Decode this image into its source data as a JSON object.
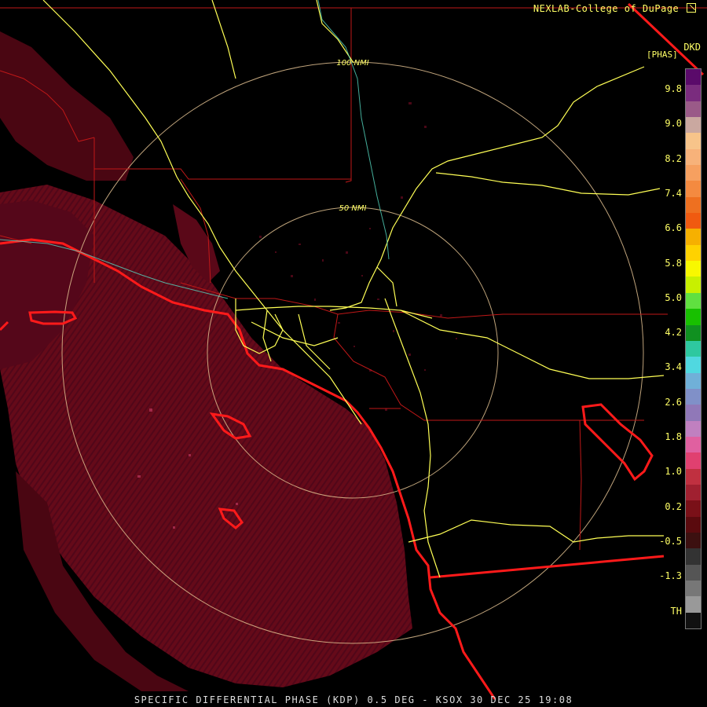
{
  "header": {
    "credit": "NEXLAB-College of DuPage"
  },
  "legend": {
    "product_code": "DKD",
    "unit": "[PHAS]",
    "ticks": [
      "9.8",
      "9.0",
      "8.2",
      "7.4",
      "6.6",
      "5.8",
      "5.0",
      "4.2",
      "3.4",
      "2.6",
      "1.8",
      "1.0",
      "0.2",
      "-0.5",
      "-1.3",
      "TH"
    ],
    "colors": [
      "#5a0a6a",
      "#7a2c7e",
      "#9a5a88",
      "#caa8a0",
      "#f7c48a",
      "#f7b27a",
      "#f6a060",
      "#f48a40",
      "#ee7020",
      "#f05a10",
      "#f6b000",
      "#ffd200",
      "#f8f800",
      "#c8f000",
      "#60e040",
      "#18c000",
      "#109020",
      "#2ec8a0",
      "#50d8e0",
      "#70b0d8",
      "#8090c8",
      "#9078b8",
      "#c080c0",
      "#e060a0",
      "#e04070",
      "#c03040",
      "#a02030",
      "#7a1018",
      "#5a0a0e",
      "#3c1010",
      "#333333",
      "#555555",
      "#777777",
      "#999999",
      "#111111"
    ]
  },
  "map": {
    "ring_labels": [
      "100 NMI",
      "50 NMI"
    ],
    "colors": {
      "coast": "#ff1a1a",
      "boundary": "#c01818",
      "highway": "#ffff55",
      "ring": "#e0c090",
      "echo": "#6e0a1c",
      "echo_dark": "#4e0614"
    }
  },
  "footer": {
    "caption": "SPECIFIC DIFFERENTIAL PHASE (KDP) 0.5 DEG - KSOX 30 DEC 25 19:08"
  }
}
